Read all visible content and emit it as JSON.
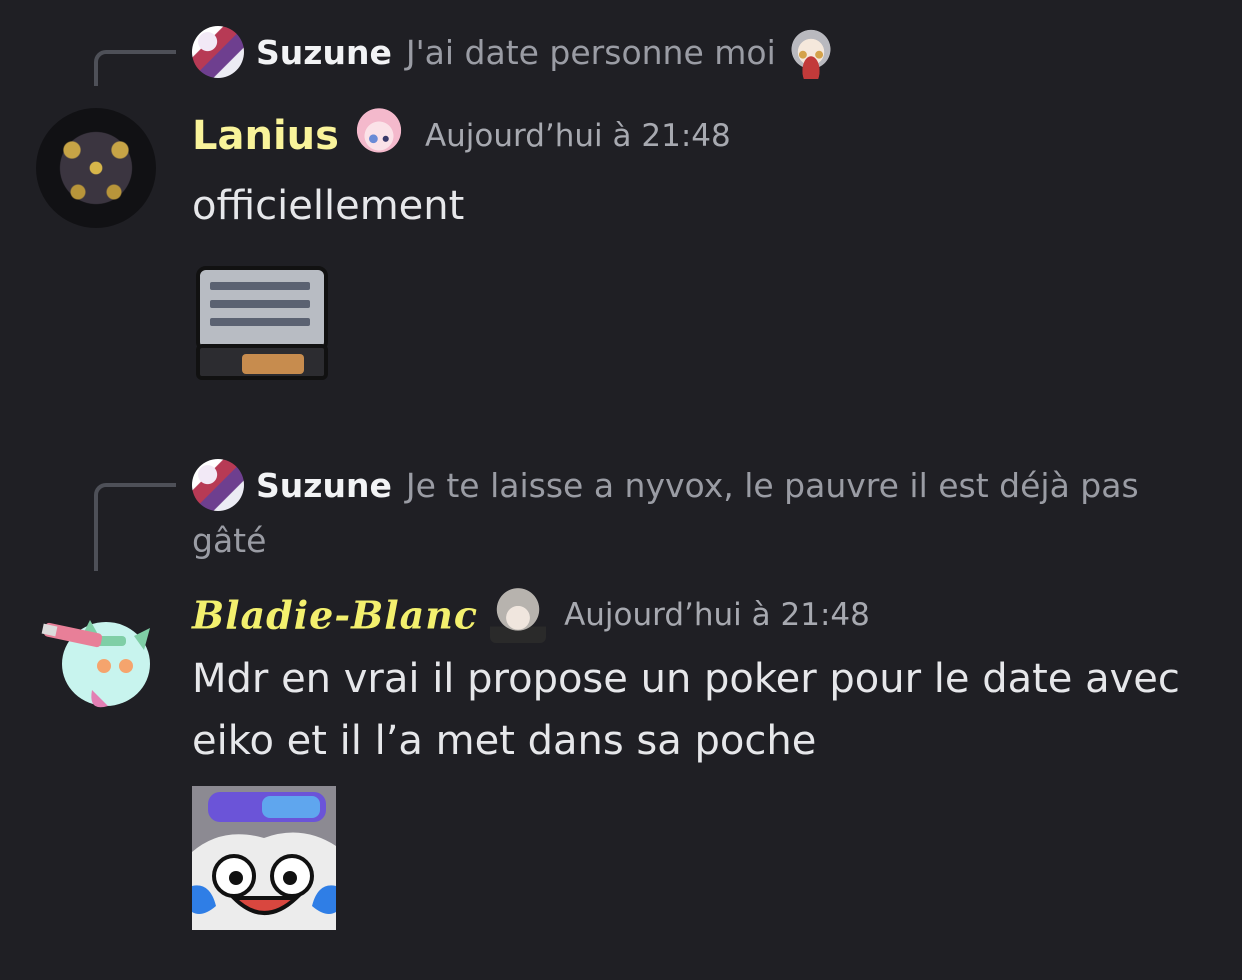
{
  "messages": [
    {
      "reply": {
        "author": "Suzune",
        "text": "J'ai date personne moi"
      },
      "author": "Lanius",
      "timestamp": "Aujourd’hui à 21:48",
      "text": "officiellement",
      "sticker": "notepad-sticker"
    },
    {
      "reply": {
        "author": "Suzune",
        "text": "Je te laisse a nyvox, le pauvre il est déjà pas gâté"
      },
      "author": "Bladie-Blanc",
      "timestamp": "Aujourd’hui à 21:48",
      "text": "Mdr en vrai il propose un poker pour le date avec eiko et il l’a met dans sa poche",
      "sticker": "laughing-face-sticker"
    }
  ],
  "colors": {
    "background": "#1f1f24",
    "lanius_name": "#f9f39a",
    "bladie_name": "#f3f06e",
    "reply_author": "#f2f3f5",
    "muted_text": "#9a9ca4",
    "message_text": "#e6e7ea"
  }
}
